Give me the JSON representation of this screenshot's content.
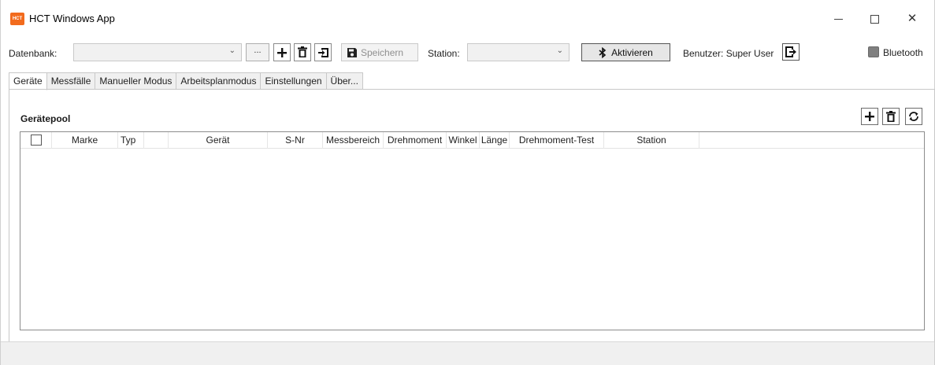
{
  "window": {
    "title": "HCT Windows App",
    "icon_text": "HCT",
    "controls": [
      "minimize",
      "maximize",
      "close"
    ],
    "close_glyph": "✕"
  },
  "toolbar": {
    "database_label": "Datenbank:",
    "database_value": "",
    "dots_label": "...",
    "save_label": "Speichern",
    "station_label": "Station:",
    "station_value": "",
    "activate_label": "Aktivieren",
    "user_label": "Benutzer: Super User",
    "bluetooth_label": "Bluetooth",
    "bluetooth_checked": false
  },
  "tabs": [
    {
      "label": "Geräte",
      "active": true
    },
    {
      "label": "Messfälle",
      "active": false
    },
    {
      "label": "Manueller Modus",
      "active": false
    },
    {
      "label": "Arbeitsplanmodus",
      "active": false
    },
    {
      "label": "Einstellungen",
      "active": false
    },
    {
      "label": "Über...",
      "active": false
    }
  ],
  "pool": {
    "title": "Gerätepool",
    "columns": [
      "Marke",
      "Typ",
      "",
      "Gerät",
      "S-Nr",
      "Messbereich",
      "Drehmoment",
      "Winkel",
      "Länge",
      "Drehmoment-Test",
      "Station"
    ],
    "rows": []
  },
  "icons": {
    "add": "plus-icon",
    "delete": "trash-icon",
    "import": "import-icon",
    "save": "floppy-icon",
    "bluetooth": "bluetooth-icon",
    "logout": "logout-icon",
    "refresh": "refresh-icon"
  },
  "colors": {
    "app_icon": "#f26b1d",
    "bluetooth_box": "#7f7f7f",
    "footer": "#f0f0f0"
  }
}
